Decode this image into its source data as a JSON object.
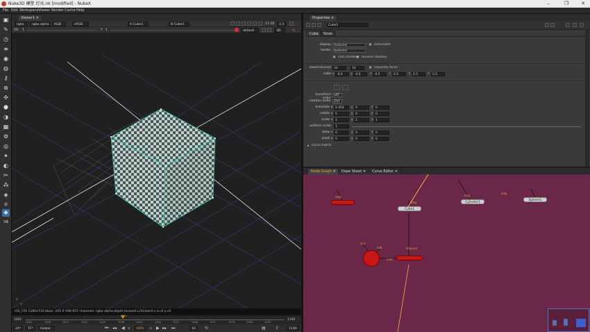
{
  "window": {
    "title": "Nuke3D 模型 灯光.nk [modified] - NukeX",
    "controls": [
      "–",
      "❐",
      "✕"
    ]
  },
  "menu": [
    "File",
    "Edit",
    "Workspace",
    "Viewer",
    "Render",
    "Cache",
    "Help"
  ],
  "toolbar": {
    "tools": [
      "image-icon",
      "draw-icon",
      "time-icon",
      "channel-icon",
      "color-icon",
      "filter-icon",
      "keyer-icon",
      "merge-icon",
      "transform-icon",
      "3d-icon",
      "views-icon",
      "metadata-icon",
      "toolsets-icon",
      "other-icon",
      "furnace-icon",
      "ocula-icon",
      "cara-icon",
      "particles-icon",
      "deep-icon",
      "models-icon",
      "cube-icon",
      "ofx-icon",
      "nuke-logo-icon"
    ],
    "bottom_label": "VB"
  },
  "viewer": {
    "tab": "Viewer1",
    "row1": {
      "layer": "rgba",
      "channel": "rgba.alpha",
      "colorspace": "RGB",
      "lut": "sRGB",
      "input_a": "A  Cube1",
      "input_b": "B  Cube1",
      "zoom": "1:1",
      "zoom_pct": "11.08"
    },
    "row2": {
      "gain_label": "f/8",
      "gain_value": "1",
      "gamma_label": "Y",
      "gamma_value": "1",
      "camera": "default",
      "mode": "3D"
    },
    "info": "HD_720 1280x720  bbox: 205 0 598 657  channels: rgba.alpha,depth,forward.u,forward.v        x=0 y=0",
    "timeline": {
      "start": "1001",
      "end": "1100",
      "ticks": [
        "1001",
        "1008",
        "1015",
        "1022",
        "1029",
        "1036",
        "1043",
        "1050",
        "1057",
        "1064",
        "1071",
        "1078",
        "1085",
        "1092",
        "1100"
      ],
      "current": "1021"
    },
    "playbar": {
      "fps": "24*",
      "step": "TF*",
      "range": "Global",
      "frame": "1001",
      "increment": "10",
      "end": "1100"
    },
    "axis_labels": {
      "y": "Y",
      "x": "x"
    }
  },
  "properties": {
    "tab": "Properties",
    "node_name": "Cube1",
    "node_tabs": [
      "Cube",
      "Node"
    ],
    "display": {
      "label": "display",
      "value": "textured"
    },
    "selectable": "selectable",
    "render": {
      "label": "render",
      "value": "textured"
    },
    "cast_shadow": "cast shadow",
    "receive_shadow": "receive shadow",
    "rows_columns": {
      "label": "rows/columns",
      "rows": "10",
      "cols": "10"
    },
    "separate_faces": "separate faces",
    "cube": {
      "label": "cube",
      "x": "-0.5",
      "y": "-0.5",
      "n": "-0.5",
      "r": "0.5",
      "t": "0.5",
      "f": "0.5"
    },
    "transform_order": {
      "label": "transform order",
      "value": "SRT"
    },
    "rotation_order": {
      "label": "rotation order",
      "value": "ZXY"
    },
    "translate": {
      "label": "translate",
      "x": "0.454",
      "y": "0",
      "z": "0"
    },
    "rotate": {
      "label": "rotate",
      "x": "0",
      "y": "0",
      "z": "0"
    },
    "scale": {
      "label": "scale",
      "x": "1",
      "y": "1",
      "z": "1"
    },
    "uniform_scale": {
      "label": "uniform scale",
      "value": "1"
    },
    "skew": {
      "label": "skew",
      "x": "0",
      "y": "0",
      "z": "0"
    },
    "pivot": {
      "label": "pivot",
      "x": "0",
      "y": "0",
      "z": "0"
    },
    "local_matrix": "Local matrix"
  },
  "nodegraph": {
    "tabs": [
      "Node Graph",
      "Dope Sheet",
      "Curve Editor"
    ],
    "nodes": [
      {
        "name": "Cube1",
        "label": "img"
      },
      {
        "name": "Cylinder1",
        "label": "img"
      },
      {
        "name": "Sphere1",
        "label": "img"
      },
      {
        "name": "",
        "label": "img"
      },
      {
        "name": "",
        "label": "img"
      },
      {
        "name": "",
        "label": "img  scn"
      }
    ],
    "free_labels": [
      "img",
      "scn",
      "sub",
      "cam"
    ]
  }
}
